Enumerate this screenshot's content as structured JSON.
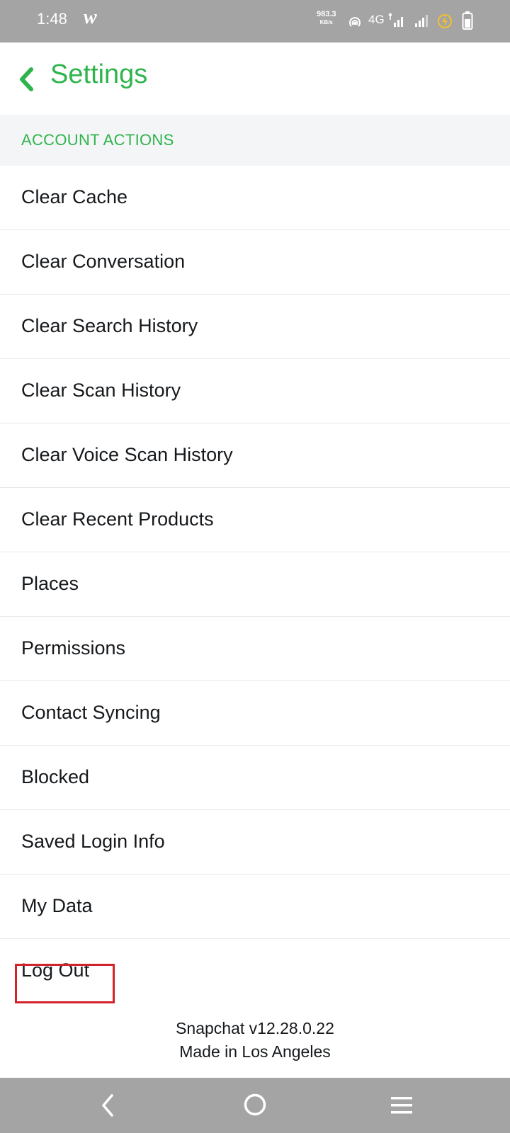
{
  "status_bar": {
    "time": "1:48",
    "app_logo": "w",
    "net_speed_value": "983.3",
    "net_speed_unit": "KB/s",
    "network_type": "4G"
  },
  "header": {
    "title": "Settings"
  },
  "section": {
    "label": "ACCOUNT ACTIONS"
  },
  "menu": {
    "items": [
      {
        "label": "Clear Cache"
      },
      {
        "label": "Clear Conversation"
      },
      {
        "label": "Clear Search History"
      },
      {
        "label": "Clear Scan History"
      },
      {
        "label": "Clear Voice Scan History"
      },
      {
        "label": "Clear Recent Products"
      },
      {
        "label": "Places"
      },
      {
        "label": "Permissions"
      },
      {
        "label": "Contact Syncing"
      },
      {
        "label": "Blocked"
      },
      {
        "label": "Saved Login Info"
      },
      {
        "label": "My Data"
      },
      {
        "label": "Log Out"
      }
    ]
  },
  "footer": {
    "version": "Snapchat v12.28.0.22",
    "made_in": "Made in Los Angeles"
  },
  "colors": {
    "accent": "#2fb44d",
    "highlight": "#d3222a",
    "system_bar": "#a4a4a4"
  },
  "icons": {
    "back": "chevron-left-icon",
    "hotspot": "hotspot-icon",
    "signal": "signal-icon",
    "charging": "charging-icon",
    "battery": "battery-icon",
    "nav_back": "nav-back-icon",
    "nav_home": "nav-home-icon",
    "nav_recent": "nav-menu-icon"
  }
}
